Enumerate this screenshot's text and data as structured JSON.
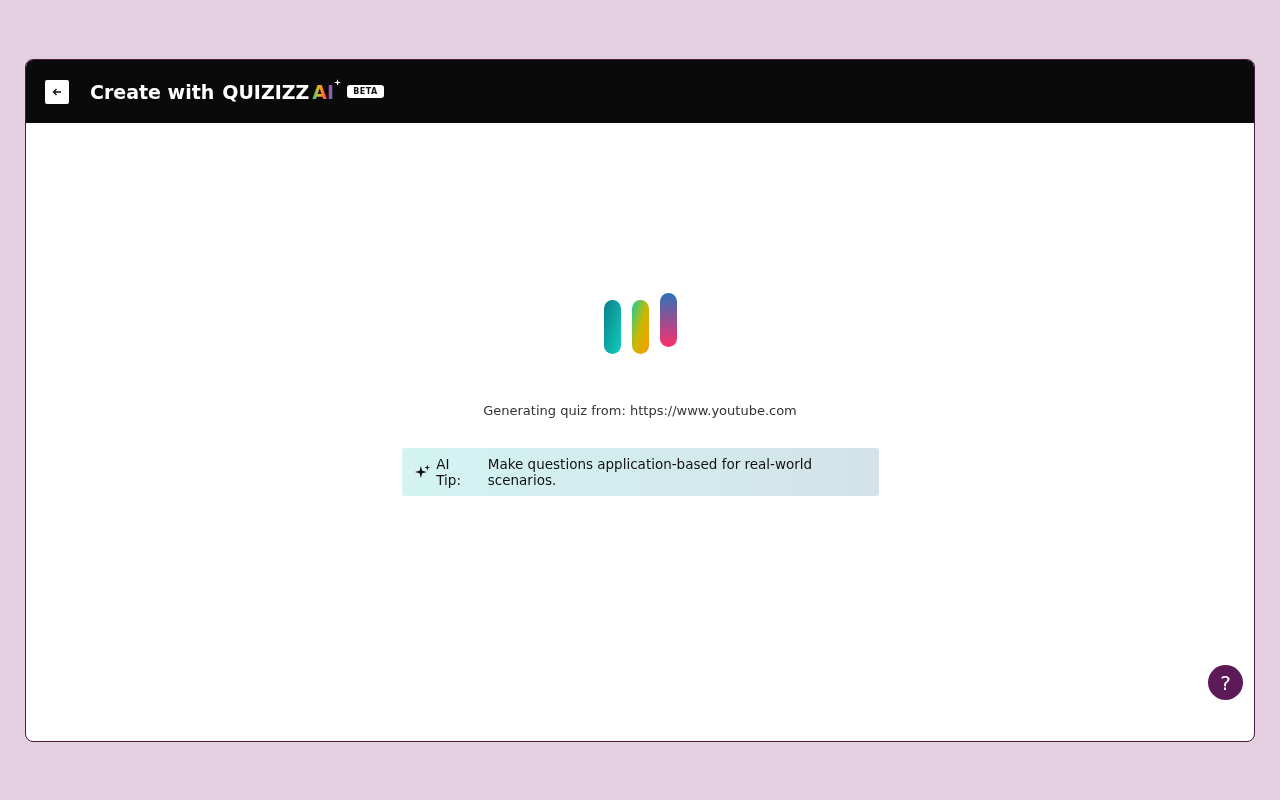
{
  "header": {
    "title": "Create with",
    "logo_word": "QUIZIZZ",
    "logo_ai": "AI",
    "badge": "BETA"
  },
  "status": "Generating quiz from: https://www.youtube.com",
  "tip": {
    "label": "AI Tip:",
    "text": "Make questions application-based for real-world scenarios."
  },
  "help": {
    "glyph": "?"
  }
}
